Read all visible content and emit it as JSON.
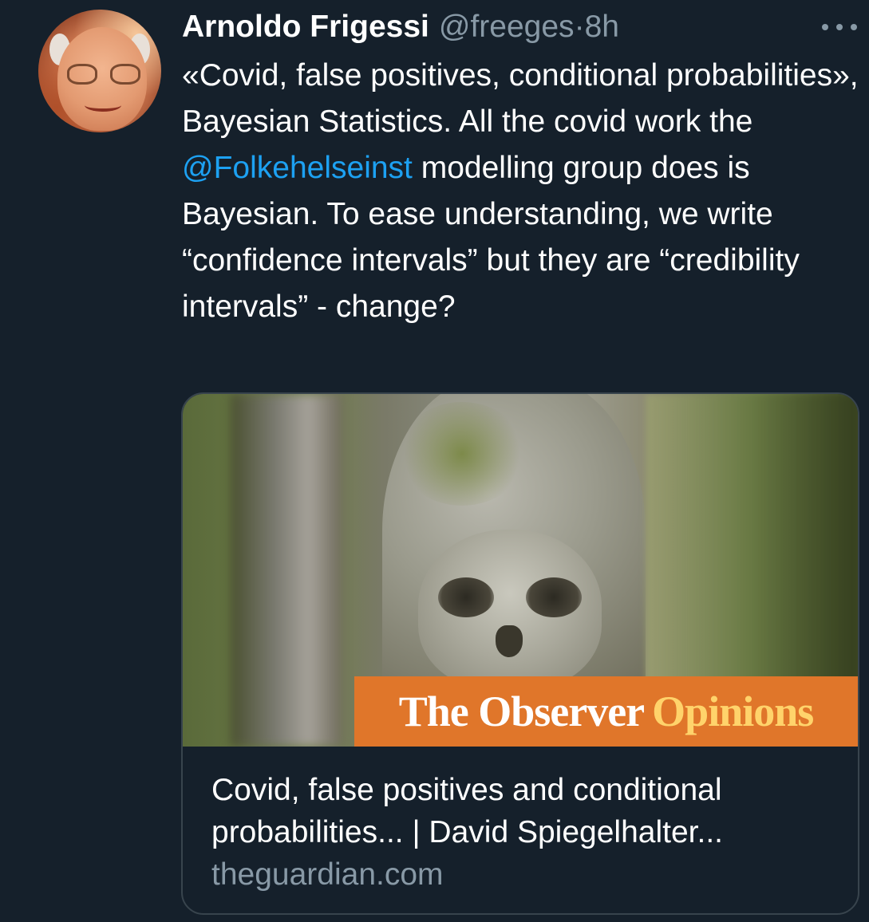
{
  "tweet": {
    "author_name": "Arnoldo Frigessi",
    "author_handle": "@freeges",
    "separator": "·",
    "timestamp": "8h",
    "body_before_mention": "«Covid, false positives, conditional probabilities», Bayesian Statistics. All the covid work the ",
    "mention": "@Folkehelseinst",
    "body_after_mention": " modelling group does is Bayesian. To ease understanding, we write “confidence intervals” but they are “credibility intervals” - change?"
  },
  "card": {
    "banner_left": "The Observer",
    "banner_right": "Opinions",
    "title": "Covid, false positives and conditional probabilities... | David Spiegelhalter...",
    "domain": "theguardian.com"
  },
  "icons": {
    "more": "more-horizontal-icon",
    "avatar": "avatar"
  },
  "colors": {
    "background": "#15202b",
    "link": "#1da1f2",
    "secondary_text": "#8899a6",
    "card_border": "#38444d",
    "banner": "#e0762a"
  }
}
